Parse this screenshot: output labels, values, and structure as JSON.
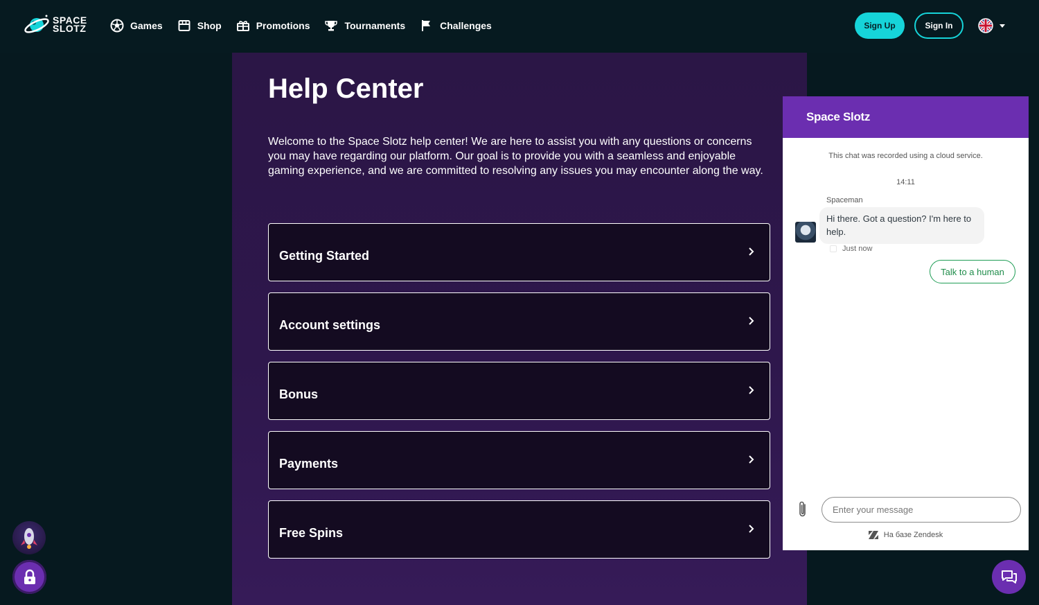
{
  "header": {
    "logo": {
      "line1": "SPACE",
      "line2": "SLOTZ"
    },
    "nav": [
      {
        "label": "Games",
        "icon": "soccer-ball-icon"
      },
      {
        "label": "Shop",
        "icon": "shop-icon"
      },
      {
        "label": "Promotions",
        "icon": "gift-icon"
      },
      {
        "label": "Tournaments",
        "icon": "trophy-icon"
      },
      {
        "label": "Challenges",
        "icon": "flag-icon"
      }
    ],
    "sign_up_label": "Sign Up",
    "sign_in_label": "Sign In",
    "language_icon": "uk-flag-icon"
  },
  "main": {
    "title": "Help Center",
    "intro": "Welcome to the Space Slotz help center! We are here to assist you with any questions or concerns you may have regarding our platform. Our goal is to provide you with a seamless and enjoyable gaming experience, and we are committed to resolving any issues you may encounter along the way.",
    "categories": [
      {
        "label": "Getting Started"
      },
      {
        "label": "Account settings"
      },
      {
        "label": "Bonus"
      },
      {
        "label": "Payments"
      },
      {
        "label": "Free Spins"
      }
    ]
  },
  "chat": {
    "title": "Space Slotz",
    "notice": "This chat was recorded using a cloud service.",
    "time": "14:11",
    "sender": "Spaceman",
    "message": "Hi there. Got a question? I'm here to help.",
    "status": "Just now",
    "talk_label": "Talk to a human",
    "input_placeholder": "Enter your message",
    "powered_by": "На базе Zendesk"
  },
  "colors": {
    "accent_cyan": "#16d4d9",
    "chat_purple": "#6b2eb0",
    "page_bg": "#06191f",
    "panel_bg": "#2b1646",
    "talk_green": "#1f9d55"
  }
}
